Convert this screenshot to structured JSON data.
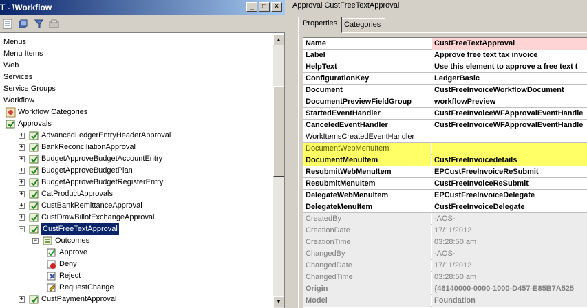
{
  "left": {
    "title": "T - \\Workflow",
    "tree": [
      {
        "label": "Menus",
        "indent": 0,
        "icon": "none",
        "expander": "none"
      },
      {
        "label": "Menu Items",
        "indent": 0,
        "icon": "none",
        "expander": "none"
      },
      {
        "label": "Web",
        "indent": 0,
        "icon": "none",
        "expander": "none"
      },
      {
        "label": "Services",
        "indent": 0,
        "icon": "none",
        "expander": "none"
      },
      {
        "label": "Service Groups",
        "indent": 0,
        "icon": "none",
        "expander": "none"
      },
      {
        "label": "Workflow",
        "indent": 0,
        "icon": "none",
        "expander": "none"
      },
      {
        "label": "Workflow Categories",
        "indent": 1,
        "icon": "category-icon",
        "expander": "none"
      },
      {
        "label": "Approvals",
        "indent": 1,
        "icon": "approvals-icon",
        "expander": "none"
      },
      {
        "label": "AdvancedLedgerEntryHeaderApproval",
        "indent": 2,
        "icon": "approval-icon",
        "expander": "+"
      },
      {
        "label": "BankReconciliationApproval",
        "indent": 2,
        "icon": "approval-icon",
        "expander": "+"
      },
      {
        "label": "BudgetApproveBudgetAccountEntry",
        "indent": 2,
        "icon": "approval-icon",
        "expander": "+"
      },
      {
        "label": "BudgetApproveBudgetPlan",
        "indent": 2,
        "icon": "approval-icon",
        "expander": "+"
      },
      {
        "label": "BudgetApproveBudgetRegisterEntry",
        "indent": 2,
        "icon": "approval-icon",
        "expander": "+"
      },
      {
        "label": "CatProductApprovals",
        "indent": 2,
        "icon": "approval-icon",
        "expander": "+"
      },
      {
        "label": "CustBankRemittanceApproval",
        "indent": 2,
        "icon": "approval-icon",
        "expander": "+"
      },
      {
        "label": "CustDrawBillofExchangeApproval",
        "indent": 2,
        "icon": "approval-icon",
        "expander": "+"
      },
      {
        "label": "CustFreeTextApproval",
        "indent": 2,
        "icon": "approval-icon",
        "expander": "-",
        "selected": true
      },
      {
        "label": "Outcomes",
        "indent": 3,
        "icon": "outcomes-icon",
        "expander": "-"
      },
      {
        "label": "Approve",
        "indent": 4,
        "icon": "approve-icon",
        "expander": "none"
      },
      {
        "label": "Deny",
        "indent": 4,
        "icon": "deny-icon",
        "expander": "none"
      },
      {
        "label": "Reject",
        "indent": 4,
        "icon": "reject-icon",
        "expander": "none"
      },
      {
        "label": "RequestChange",
        "indent": 4,
        "icon": "request-change-icon",
        "expander": "none"
      },
      {
        "label": "CustPaymentApproval",
        "indent": 2,
        "icon": "approval-icon",
        "expander": "+"
      }
    ],
    "toolbar_icons": [
      "properties-icon",
      "compile-icon",
      "filter-icon",
      "find-icon"
    ]
  },
  "right": {
    "title": "Approval CustFreeTextApproval",
    "tabs": [
      "Properties",
      "Categories"
    ],
    "active_tab": "Properties",
    "properties": [
      {
        "name": "Name",
        "value": "CustFreeTextApproval",
        "style": "bold",
        "value_highlight": true
      },
      {
        "name": "Label",
        "value": "Approve free text tax invoice",
        "style": "bold"
      },
      {
        "name": "HelpText",
        "value": "Use this element to approve a free text t",
        "style": "bold"
      },
      {
        "name": "ConfigurationKey",
        "value": "LedgerBasic",
        "style": "bold"
      },
      {
        "name": "Document",
        "value": "CustFreeInvoiceWorkflowDocument",
        "style": "bold"
      },
      {
        "name": "DocumentPreviewFieldGroup",
        "value": "workflowPreview",
        "style": "bold"
      },
      {
        "name": "StartedEventHandler",
        "value": "CustFreeInvoiceWFApprovalEventHandle",
        "style": "bold"
      },
      {
        "name": "CanceledEventHandler",
        "value": "CustFreeInvoiceWFApprovalEventHandle",
        "style": "bold"
      },
      {
        "name": "WorkItemsCreatedEventHandler",
        "value": "",
        "style": "normal"
      },
      {
        "name": "DocumentWebMenuItem",
        "value": "",
        "style": "normal",
        "marked": true
      },
      {
        "name": "DocumentMenuItem",
        "value": "CustFreeInvoicedetails",
        "style": "bold",
        "marked": true
      },
      {
        "name": "ResubmitWebMenuItem",
        "value": "EPCustFreeInvoiceReSubmit",
        "style": "bold"
      },
      {
        "name": "ResubmitMenuItem",
        "value": "CustFreeInvoiceReSubmit",
        "style": "bold"
      },
      {
        "name": "DelegateWebMenuItem",
        "value": "EPCustFreeInvoiceDelegate",
        "style": "bold"
      },
      {
        "name": "DelegateMenuItem",
        "value": "CustFreeInvoiceDelegate",
        "style": "bold"
      },
      {
        "name": "CreatedBy",
        "value": "-AOS-",
        "style": "readonly"
      },
      {
        "name": "CreationDate",
        "value": "17/11/2012",
        "style": "readonly"
      },
      {
        "name": "CreationTime",
        "value": "03:28:50 am",
        "style": "readonly"
      },
      {
        "name": "ChangedBy",
        "value": "-AOS-",
        "style": "readonly"
      },
      {
        "name": "ChangedDate",
        "value": "17/11/2012",
        "style": "readonly"
      },
      {
        "name": "ChangedTime",
        "value": "03:28:50 am",
        "style": "readonly"
      },
      {
        "name": "Origin",
        "value": "{46140000-0000-1000-D457-E85B7A525",
        "style": "readonly-bold"
      },
      {
        "name": "Model",
        "value": "Foundation",
        "style": "readonly-bold"
      }
    ]
  },
  "colors": {
    "selection": "#0a246a",
    "marker_yellow": "#ffff66",
    "name_value_highlight": "#ffd4d4"
  }
}
